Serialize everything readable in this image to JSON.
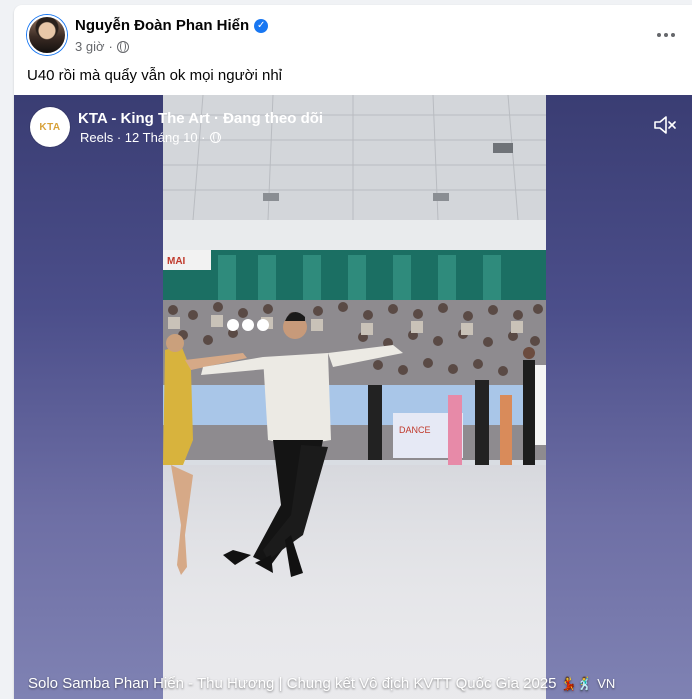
{
  "post": {
    "author": "Nguyễn Đoàn Phan Hiển",
    "verified_mark": "✓",
    "time": "3 giờ",
    "separator": "·",
    "privacy_icon": "globe-icon",
    "text": "U40 rồi mà quẩy vẫn ok mọi người nhỉ"
  },
  "reel": {
    "page_name": "KTA - King The Art",
    "follow_status": "· Đang theo dõi",
    "page_logo_text": "KTA",
    "meta": "Reels · 12 Tháng 10 ·",
    "caption": "Solo Samba Phan Hiển - Thu Hương | Chung kết Vô địch KVTT Quốc Gia 2025",
    "caption_emojis": "💃🕺",
    "caption_flag": "VN",
    "mute_icon": "speaker-muted-icon"
  },
  "colors": {
    "brand_blue": "#1877f2",
    "reel_bg": "#4b4e8a"
  }
}
